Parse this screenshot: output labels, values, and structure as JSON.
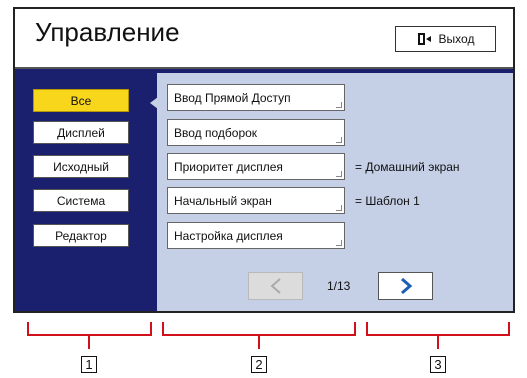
{
  "header": {
    "title": "Управление",
    "exit_label": "Выход"
  },
  "categories": [
    {
      "label": "Все",
      "active": true
    },
    {
      "label": "Дисплей",
      "active": false
    },
    {
      "label": "Исходный",
      "active": false
    },
    {
      "label": "Система",
      "active": false
    },
    {
      "label": "Редактор",
      "active": false
    }
  ],
  "items": [
    {
      "label": "Ввод Прямой Доступ",
      "value": ""
    },
    {
      "label": "Ввод подборок",
      "value": ""
    },
    {
      "label": "Приоритет дисплея",
      "value": "= Домашний экран"
    },
    {
      "label": "Начальный экран",
      "value": "= Шаблон 1"
    },
    {
      "label": "Настройка дисплея",
      "value": ""
    }
  ],
  "pagination": {
    "text": "1/13"
  },
  "callouts": [
    "1",
    "2",
    "3"
  ],
  "colors": {
    "accent": "#f7d61b",
    "frame": "#1a1f6e",
    "panel": "#c5cfe6",
    "callout": "#d0101a"
  }
}
